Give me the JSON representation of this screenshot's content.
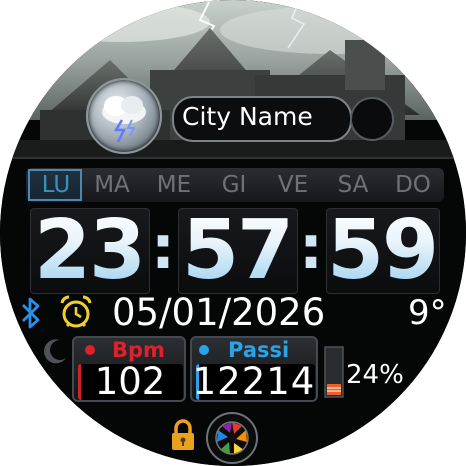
{
  "weather": {
    "city_name": "City Name",
    "icon": "thunderstorm-icon"
  },
  "days": {
    "items": [
      "LU",
      "MA",
      "ME",
      "GI",
      "VE",
      "SA",
      "DO"
    ],
    "active_index": 0
  },
  "time": {
    "hours": "23",
    "minutes": "57",
    "seconds": "59",
    "separator": ":"
  },
  "status": {
    "date": "05/01/2026",
    "temperature": "9°",
    "bluetooth_icon": "bluetooth-icon",
    "alarm_icon": "alarm-clock-icon",
    "night_icon": "moon-icon"
  },
  "heart": {
    "label": "Bpm",
    "value": "102",
    "color": "#e0202a"
  },
  "steps": {
    "label": "Passi",
    "value": "12214",
    "color": "#2aa3e8"
  },
  "battery": {
    "percent_text": "24%",
    "level": 0.24,
    "icon": "battery-icon"
  },
  "bottom": {
    "lock_icon": "lock-icon",
    "shutter_icon": "camera-shutter-icon"
  },
  "colors": {
    "accent": "#4cc0f2",
    "inactive_day": "#6d7276",
    "alarm": "#f0d12a"
  }
}
